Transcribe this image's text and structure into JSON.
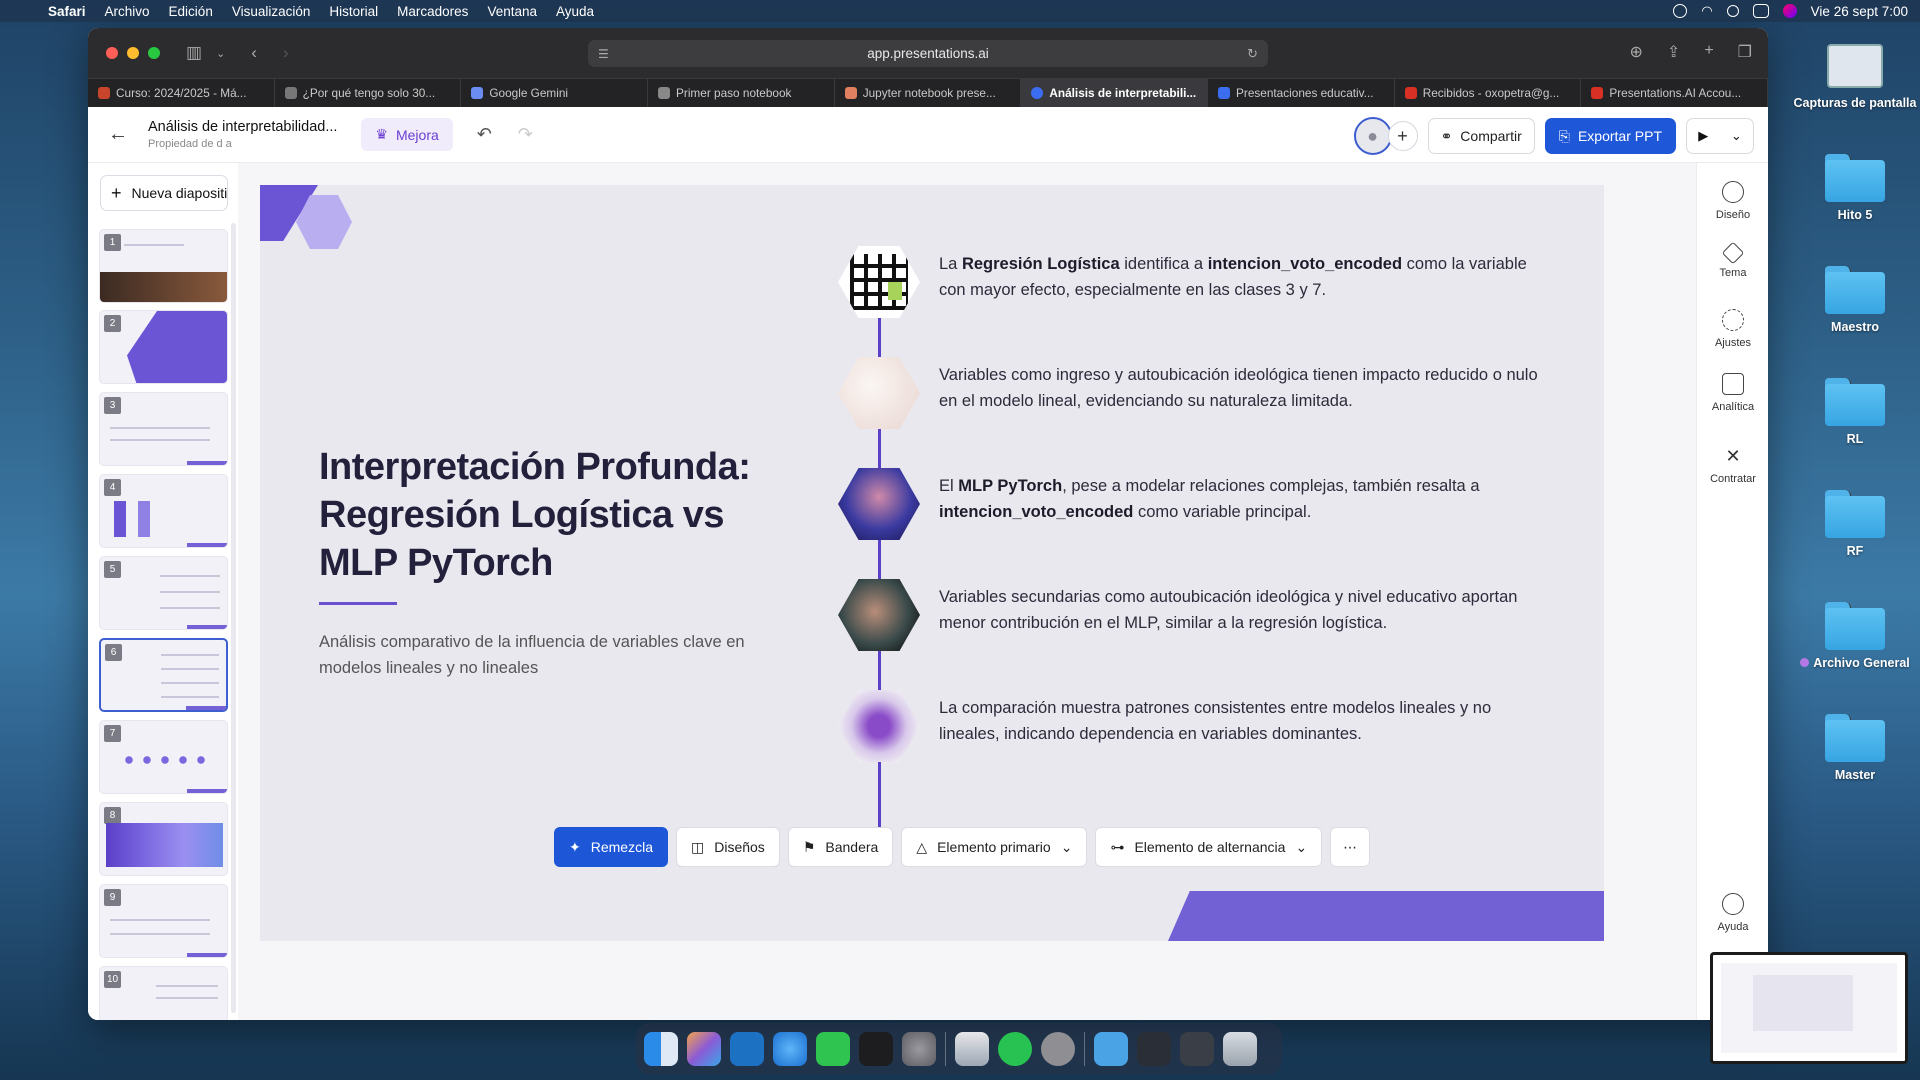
{
  "menubar": {
    "app": "Safari",
    "items": [
      "Archivo",
      "Edición",
      "Visualización",
      "Historial",
      "Marcadores",
      "Ventana",
      "Ayuda"
    ],
    "datetime": "Vie 26 sept 7:00"
  },
  "desktop": {
    "items": [
      {
        "label": "Capturas de pantalla"
      },
      {
        "label": "Hito 5"
      },
      {
        "label": "Maestro"
      },
      {
        "label": "RL"
      },
      {
        "label": "RF"
      },
      {
        "label": "Archivo General"
      },
      {
        "label": "Master"
      }
    ]
  },
  "browser": {
    "url": "app.presentations.ai",
    "tabs": [
      {
        "label": "Curso: 2024/2025 - Má...",
        "color": "#c8452c"
      },
      {
        "label": "¿Por qué tengo solo 30...",
        "color": "#777777"
      },
      {
        "label": "Google Gemini",
        "color": "#6b8cf0"
      },
      {
        "label": "Primer paso notebook",
        "color": "#888888"
      },
      {
        "label": "Jupyter notebook prese...",
        "color": "#e08060"
      },
      {
        "label": "Análisis de interpretabili...",
        "color": "#3a6df0",
        "active": true
      },
      {
        "label": "Presentaciones educativ...",
        "color": "#3a6df0"
      },
      {
        "label": "Recibidos - oxopetra@g...",
        "color": "#d93025"
      },
      {
        "label": "Presentations.AI Accou...",
        "color": "#d93025"
      }
    ]
  },
  "app": {
    "doc_title": "Análisis de interpretabilidad...",
    "doc_subtitle": "Propiedad de d a",
    "upgrade_label": "Mejora",
    "share_label": "Compartir",
    "export_label": "Exportar PPT",
    "new_slide_label": "Nueva diapositiva",
    "slide_numbers": [
      "1",
      "2",
      "3",
      "4",
      "5",
      "6",
      "7",
      "8",
      "9",
      "10"
    ],
    "selected_slide": 6
  },
  "slide": {
    "title": "Interpretación Profunda: Regresión Logística vs MLP PyTorch",
    "subtitle": "Análisis comparativo de la influencia de variables clave en modelos lineales y no lineales",
    "items": [
      {
        "t1": "La ",
        "b1": "Regresión Logística",
        "t2": " identifica a ",
        "b2": "intencion_voto_encoded",
        "t3": " como la variable con mayor efecto, especialmente en las clases 3 y 7."
      },
      {
        "t1": "Variables como ingreso y autoubicación ideológica tienen impacto reducido o nulo en el modelo lineal, evidenciando su naturaleza limitada.",
        "b1": "",
        "t2": "",
        "b2": "",
        "t3": ""
      },
      {
        "t1": "El ",
        "b1": "MLP PyTorch",
        "t2": ", pese a modelar relaciones complejas, también resalta a ",
        "b2": "intencion_voto_encoded",
        "t3": " como variable principal."
      },
      {
        "t1": "Variables secundarias como autoubicación ideológica y nivel educativo aportan menor contribución en el MLP, similar a la regresión logística.",
        "b1": "",
        "t2": "",
        "b2": "",
        "t3": ""
      },
      {
        "t1": "La comparación muestra patrones consistentes entre modelos lineales y no lineales, indicando dependencia en variables dominantes.",
        "b1": "",
        "t2": "",
        "b2": "",
        "t3": ""
      }
    ]
  },
  "bottom_toolbar": {
    "remix": "Remezcla",
    "layouts": "Diseños",
    "flag": "Bandera",
    "primary_element": "Elemento primario",
    "toggle_element": "Elemento de alternancia"
  },
  "right_panel": {
    "design": "Diseño",
    "theme": "Tema",
    "settings": "Ajustes",
    "analytics": "Analítica",
    "hire": "Contratar",
    "help": "Ayuda"
  },
  "colors": {
    "accent": "#6b55d5",
    "primary_button": "#1e57d8",
    "slide_bg": "#e9e8ef"
  }
}
